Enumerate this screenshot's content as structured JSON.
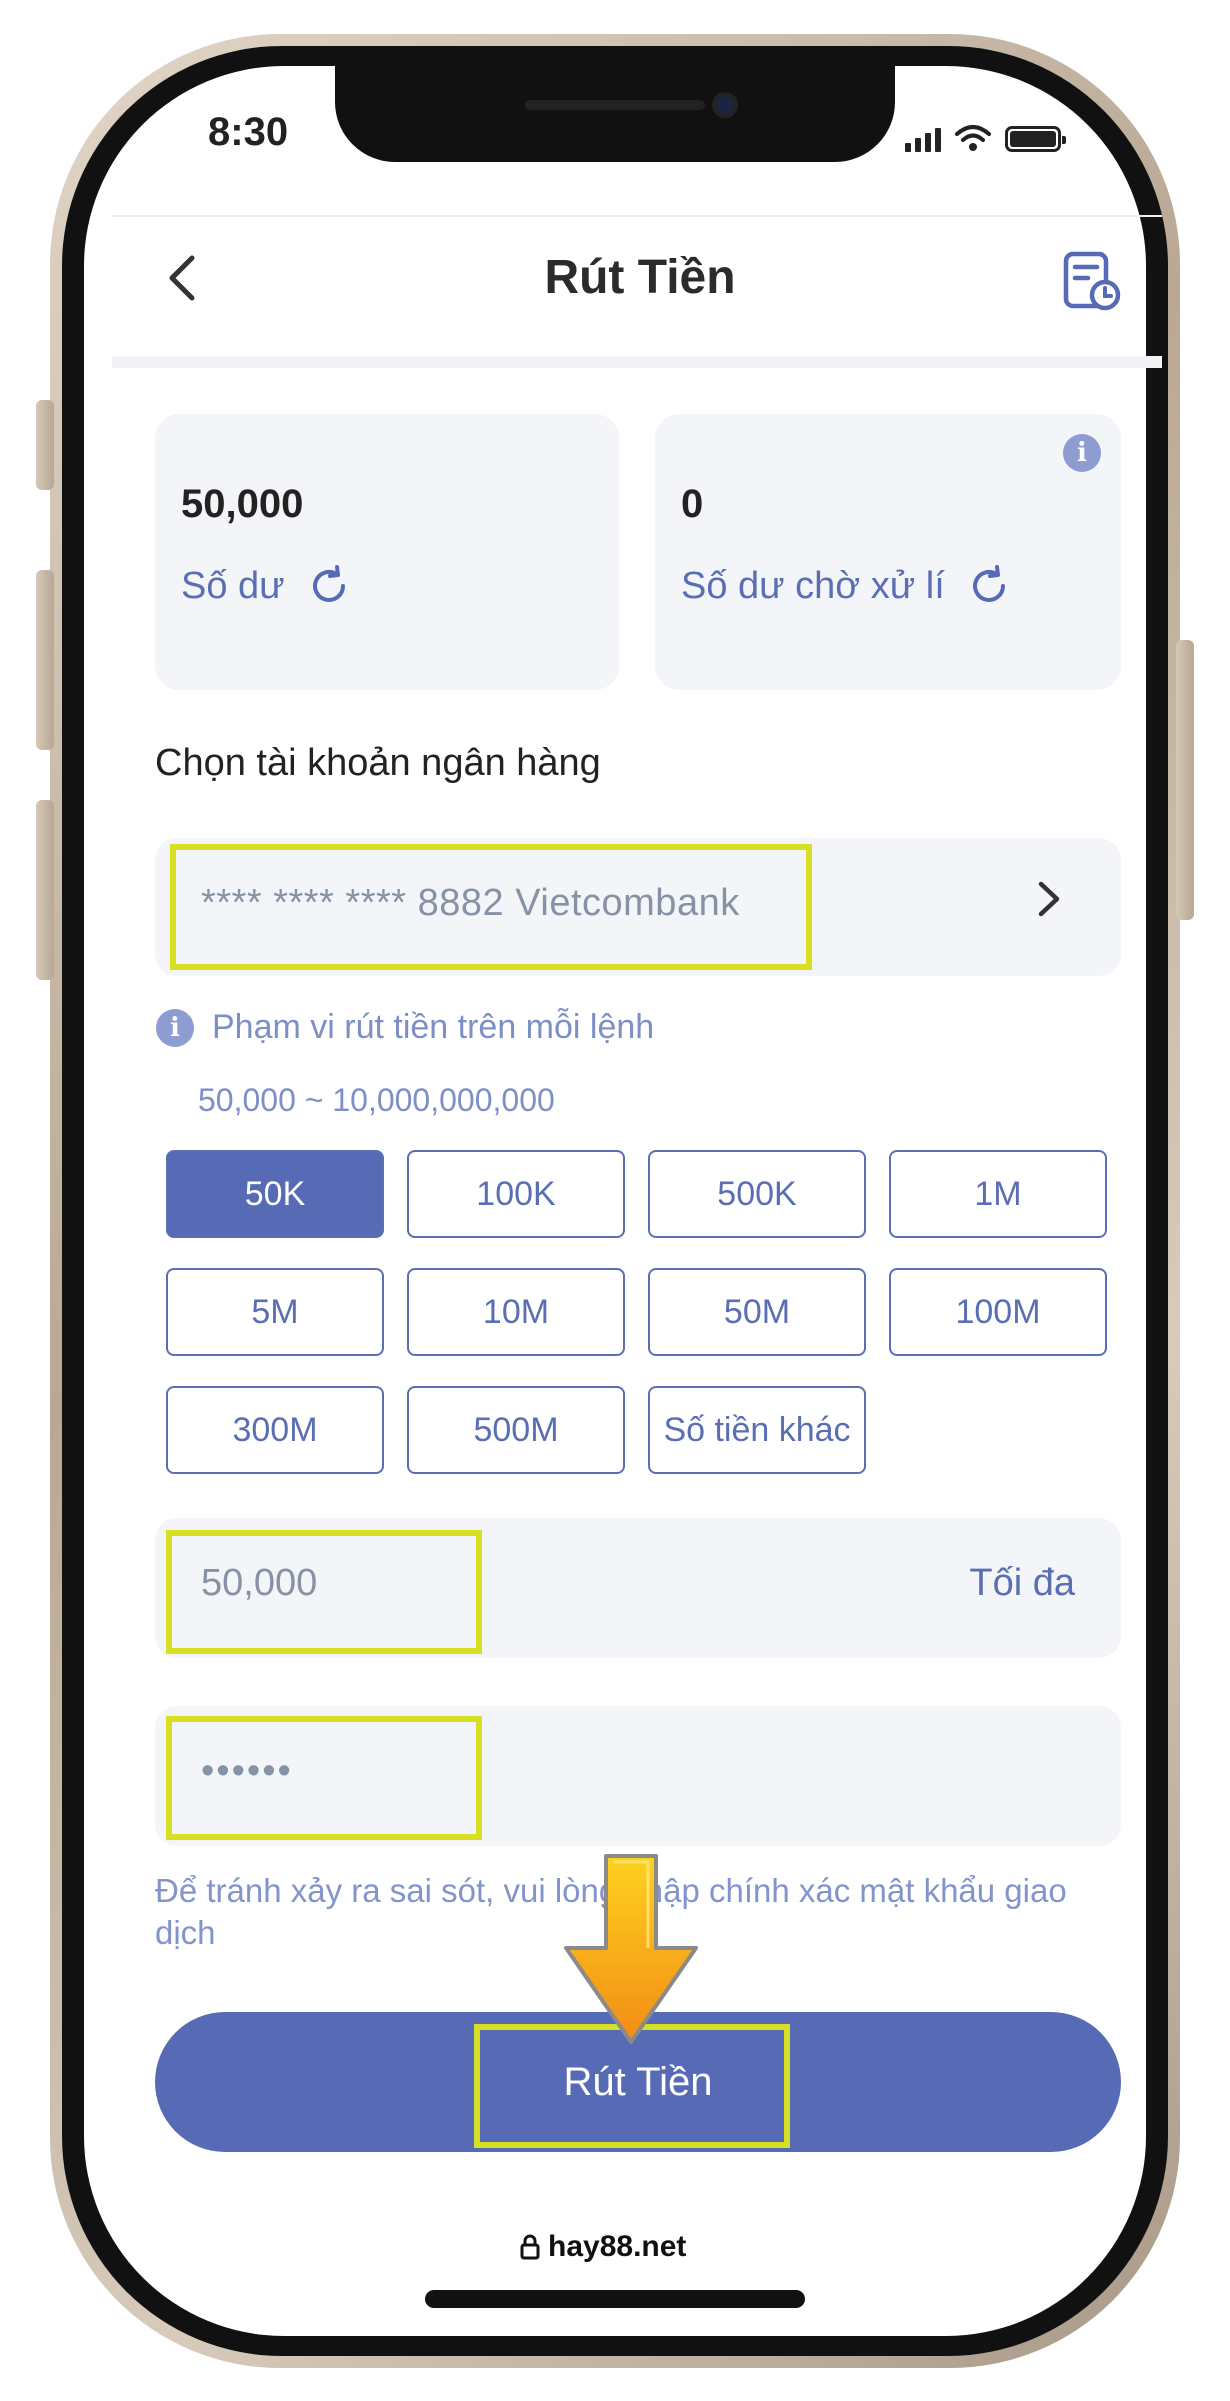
{
  "status_bar": {
    "time": "8:30"
  },
  "header": {
    "title": "Rút Tiền"
  },
  "balances": {
    "available": {
      "value": "50,000",
      "label": "Số dư"
    },
    "pending": {
      "value": "0",
      "label": "Số dư chờ xử lí"
    }
  },
  "bank": {
    "section_label": "Chọn tài khoản ngân hàng",
    "selected": "**** **** **** 8882 Vietcombank"
  },
  "range": {
    "label": "Phạm vi rút tiền trên mỗi lệnh",
    "value": "50,000 ~ 10,000,000,000"
  },
  "amount_options": [
    {
      "label": "50K",
      "selected": true
    },
    {
      "label": "100K",
      "selected": false
    },
    {
      "label": "500K",
      "selected": false
    },
    {
      "label": "1M",
      "selected": false
    },
    {
      "label": "5M",
      "selected": false
    },
    {
      "label": "10M",
      "selected": false
    },
    {
      "label": "50M",
      "selected": false
    },
    {
      "label": "100M",
      "selected": false
    },
    {
      "label": "300M",
      "selected": false
    },
    {
      "label": "500M",
      "selected": false
    },
    {
      "label": "Số tiền khác",
      "selected": false
    }
  ],
  "amount_input": {
    "value": "50,000",
    "max_label": "Tối đa"
  },
  "password_input": {
    "value": "••••••"
  },
  "hint": "Để tránh xảy ra sai sót, vui lòng nhập chính xác mật khẩu giao dịch",
  "submit": {
    "label": "Rút Tiền"
  },
  "footer": {
    "url": "hay88.net"
  },
  "colors": {
    "accent": "#566ab5",
    "highlight": "#d8e023",
    "arrow": "#f7a11a"
  }
}
